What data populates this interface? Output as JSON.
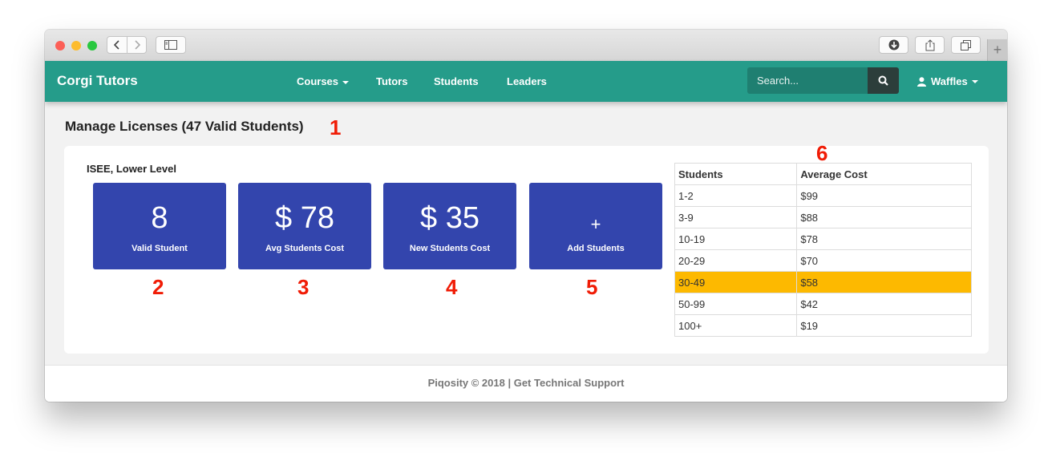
{
  "navbar": {
    "brand": "Corgi Tutors",
    "links": [
      "Courses",
      "Tutors",
      "Students",
      "Leaders"
    ],
    "search_placeholder": "Search...",
    "user": "Waffles",
    "color": "#259c8a"
  },
  "page": {
    "title": "Manage Licenses (47 Valid Students)"
  },
  "annotations": [
    "1",
    "2",
    "3",
    "4",
    "5",
    "6"
  ],
  "section": {
    "label": "ISEE, Lower Level",
    "cards": [
      {
        "value": "8",
        "label": "Valid Student"
      },
      {
        "value": "$ 78",
        "label": "Avg Students Cost"
      },
      {
        "value": "$ 35",
        "label": "New Students Cost"
      },
      {
        "value": "+",
        "label": "Add Students"
      }
    ],
    "card_color": "#3345ad"
  },
  "pricing": {
    "headers": [
      "Students",
      "Average Cost"
    ],
    "rows": [
      [
        "1-2",
        "$99"
      ],
      [
        "3-9",
        "$88"
      ],
      [
        "10-19",
        "$78"
      ],
      [
        "20-29",
        "$70"
      ],
      [
        "30-49",
        "$58"
      ],
      [
        "50-99",
        "$42"
      ],
      [
        "100+",
        "$19"
      ]
    ],
    "highlight_color": "#fdb900"
  },
  "footer": {
    "text": "Piqosity © 2018 | Get Technical Support"
  },
  "icons": [
    "back-icon",
    "forward-icon",
    "sidebar-icon",
    "download-icon",
    "share-icon",
    "tabs-icon",
    "plus-icon",
    "search-icon",
    "user-icon",
    "caret-down-icon"
  ]
}
